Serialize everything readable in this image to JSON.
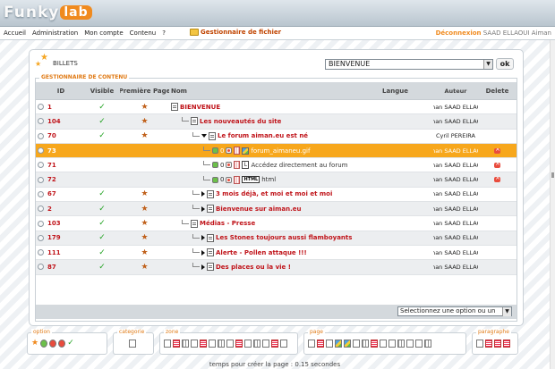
{
  "header": {
    "logo_text": "Funky",
    "logo_badge": "lab"
  },
  "nav": {
    "items": [
      "Accueil",
      "Administration",
      "Mon compte",
      "Contenu",
      "?"
    ],
    "file_manager": "Gestionnaire de fichier",
    "logout": "Déconnexion",
    "user": "SAAD ELLAOUI Aiman"
  },
  "panel": {
    "title": "BILLETS",
    "select_value": "BIENVENUE",
    "ok_label": "ok",
    "section_legend": "GESTIONNAIRE DE CONTENU"
  },
  "table": {
    "headers": {
      "id": "ID",
      "visible": "Visible",
      "premiere": "Première Page",
      "nom": "Nom",
      "langue": "Langue",
      "auteur": "Auteur",
      "delete": "Delete"
    },
    "rows": [
      {
        "id": "1",
        "visible": true,
        "star": true,
        "level": 0,
        "kind": "doc",
        "title": "BIENVENUE",
        "author": "Aiman SAAD ELLAOUI",
        "del": false,
        "bold": true
      },
      {
        "id": "104",
        "visible": true,
        "star": true,
        "level": 1,
        "kind": "doc",
        "title": "Les nouveautés du site",
        "author": "Aiman SAAD ELLAOUI",
        "del": false,
        "bold": true
      },
      {
        "id": "70",
        "visible": true,
        "star": true,
        "level": 2,
        "kind": "open",
        "title": "Le forum aiman.eu est né",
        "author": "Cyril PEREIRA",
        "del": false,
        "bold": true
      },
      {
        "id": "73",
        "visible": false,
        "star": false,
        "level": 3,
        "kind": "image",
        "title": "forum_aimaneu.gif",
        "count": "0",
        "author": "Aiman SAAD ELLAOUI",
        "del": true,
        "bold": false,
        "selected": true
      },
      {
        "id": "71",
        "visible": false,
        "star": false,
        "level": 3,
        "kind": "link",
        "title": "Accédez directement au forum",
        "count": "0",
        "author": "Aiman SAAD ELLAOUI",
        "del": true,
        "bold": false
      },
      {
        "id": "72",
        "visible": false,
        "star": false,
        "level": 3,
        "kind": "html",
        "title": "html",
        "count": "0",
        "author": "Aiman SAAD ELLAOUI",
        "del": true,
        "bold": false
      },
      {
        "id": "67",
        "visible": true,
        "star": true,
        "level": 2,
        "kind": "closed",
        "title": "3 mois déjà, et moi et moi et moi",
        "author": "Aiman SAAD ELLAOUI",
        "del": false,
        "bold": true
      },
      {
        "id": "2",
        "visible": true,
        "star": true,
        "level": 2,
        "kind": "closed",
        "title": "Bienvenue sur aiman.eu",
        "author": "Aiman SAAD ELLAOUI",
        "del": false,
        "bold": true
      },
      {
        "id": "103",
        "visible": true,
        "star": true,
        "level": 1,
        "kind": "doc",
        "title": "Médias - Presse",
        "author": "Aiman SAAD ELLAOUI",
        "del": false,
        "bold": true
      },
      {
        "id": "179",
        "visible": true,
        "star": true,
        "level": 2,
        "kind": "closed",
        "title": "Les Stones toujours aussi flamboyants",
        "author": "Aiman SAAD ELLAOUI",
        "del": false,
        "bold": true
      },
      {
        "id": "111",
        "visible": true,
        "star": true,
        "level": 2,
        "kind": "closed",
        "title": "Alerte - Pollen attaque !!!",
        "author": "Aiman SAAD ELLAOUI",
        "del": false,
        "bold": true
      },
      {
        "id": "87",
        "visible": true,
        "star": true,
        "level": 2,
        "kind": "closed",
        "title": "Des places ou la vie !",
        "author": "Aiman SAAD ELLAOUI",
        "del": false,
        "bold": true
      }
    ],
    "action_select": "Selectionnez une option ou un"
  },
  "toolbars": {
    "option": "option",
    "categorie": "categorie",
    "zone": "zone",
    "page": "page",
    "paragraphe": "paragraphe"
  },
  "footer": {
    "text": "temps pour créer la page : 0.15 secondes"
  }
}
